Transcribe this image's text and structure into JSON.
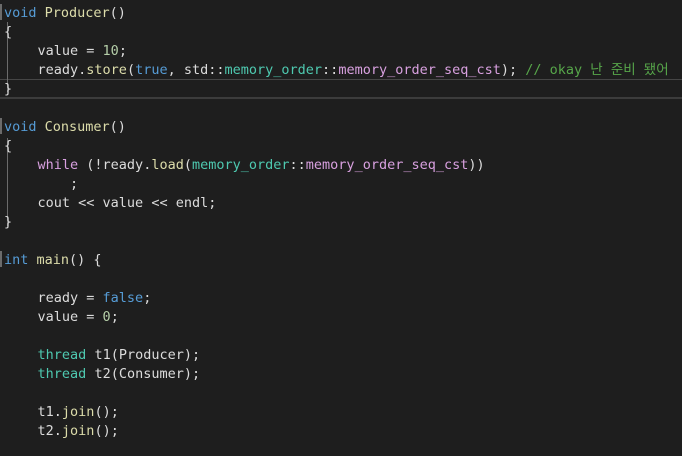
{
  "colors": {
    "background": "#1e1e1e",
    "keyword": "#569cd6",
    "function": "#dcdcaa",
    "number": "#b5cea8",
    "type": "#4ec9b0",
    "comment": "#57a64a",
    "text": "#dcdcdc"
  },
  "code": {
    "l1": {
      "kw": "void",
      "name": " Producer",
      "rest": "()"
    },
    "l2": "{",
    "l3": {
      "indent": "    ",
      "a": "value",
      "b": " = ",
      "n": "10",
      "c": ";"
    },
    "l4": {
      "indent": "    ",
      "a": "ready",
      "b": ".",
      "fn": "store",
      "c": "(",
      "kw": "true",
      "d": ", std::",
      "ty1": "memory_order",
      "e": "::",
      "f": "memory_order_seq_cst",
      "g": "); ",
      "comment": "// okay 난 준비 됐어"
    },
    "l5": "}",
    "l7": {
      "kw": "void",
      "name": " Consumer",
      "rest": "()"
    },
    "l8": "{",
    "l9": {
      "indent": "    ",
      "kw": "while",
      "a": " (!",
      "b": "ready",
      "c": ".",
      "fn": "load",
      "d": "(",
      "ty1": "memory_order",
      "e": "::",
      "f": "memory_order_seq_cst",
      "g": "))"
    },
    "l10": {
      "indent": "        ",
      "a": ";"
    },
    "l11": {
      "indent": "    ",
      "a": "cout",
      "b": " << ",
      "c": "value",
      "d": " << ",
      "e": "endl",
      "f": ";"
    },
    "l12": "}",
    "l14": {
      "kw": "int",
      "name": " main",
      "rest": "() {"
    },
    "l16": {
      "indent": "    ",
      "a": "ready",
      "b": " = ",
      "kw": "false",
      "c": ";"
    },
    "l17": {
      "indent": "    ",
      "a": "value",
      "b": " = ",
      "n": "0",
      "c": ";"
    },
    "l19": {
      "indent": "    ",
      "ty": "thread",
      "a": " ",
      "b": "t1",
      "c": "(",
      "d": "Producer",
      "e": ");"
    },
    "l20": {
      "indent": "    ",
      "ty": "thread",
      "a": " ",
      "b": "t2",
      "c": "(",
      "d": "Consumer",
      "e": ");"
    },
    "l22": {
      "indent": "    ",
      "a": "t1",
      "b": ".",
      "fn": "join",
      "c": "();"
    },
    "l23": {
      "indent": "    ",
      "a": "t2",
      "b": ".",
      "fn": "join",
      "c": "();"
    }
  }
}
